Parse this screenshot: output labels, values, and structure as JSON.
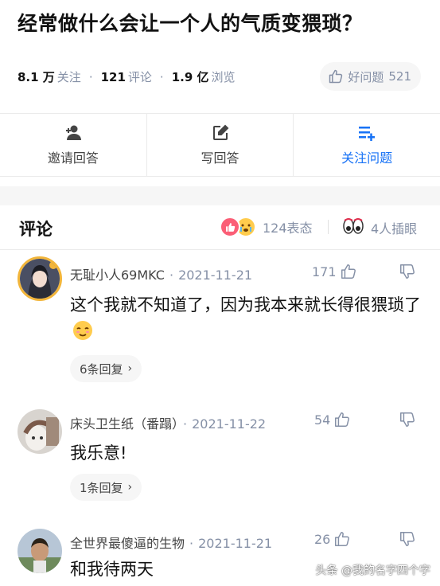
{
  "question": {
    "title": "经常做什么会让一个人的气质变猥琐？",
    "stats": [
      {
        "num": "8.1 万",
        "label": "关注"
      },
      {
        "num": "121",
        "label": "评论"
      },
      {
        "num": "1.9 亿",
        "label": "浏览"
      }
    ],
    "good_question_label": "好问题",
    "good_question_count": "521"
  },
  "actions": [
    {
      "label": "邀请回答",
      "icon": "invite-user-icon"
    },
    {
      "label": "写回答",
      "icon": "edit-icon"
    },
    {
      "label": "关注问题",
      "icon": "follow-list-icon"
    }
  ],
  "comments_header": {
    "title": "评论",
    "reactions_text": "124表态",
    "reactions_icons": [
      "like-reaction-icon",
      "cry-reaction-icon"
    ],
    "eyes_text": "4人插眼",
    "eyes_icon": "eyes-icon"
  },
  "comments": [
    {
      "user": "无耻小人69MKC",
      "date": "2021-11-21",
      "likes": "171",
      "text": "这个我就不知道了，因为我本来就长得很猥琐了",
      "emoji": "relieved-emoji",
      "replies": "6条回复"
    },
    {
      "user": "床头卫生纸（番蹋）",
      "date": "2021-11-22",
      "likes": "54",
      "text": "我乐意!",
      "replies": "1条回复"
    },
    {
      "user": "全世界最傻逼的生物",
      "date": "2021-11-21",
      "likes": "26",
      "text": "和我待两天"
    }
  ],
  "watermark": "头条 @我的名字四个字",
  "colors": {
    "accent": "#1772f6",
    "muted": "#8590a6",
    "reaction_like": "#fb5e76",
    "reaction_cry": "#ffcc4d"
  }
}
